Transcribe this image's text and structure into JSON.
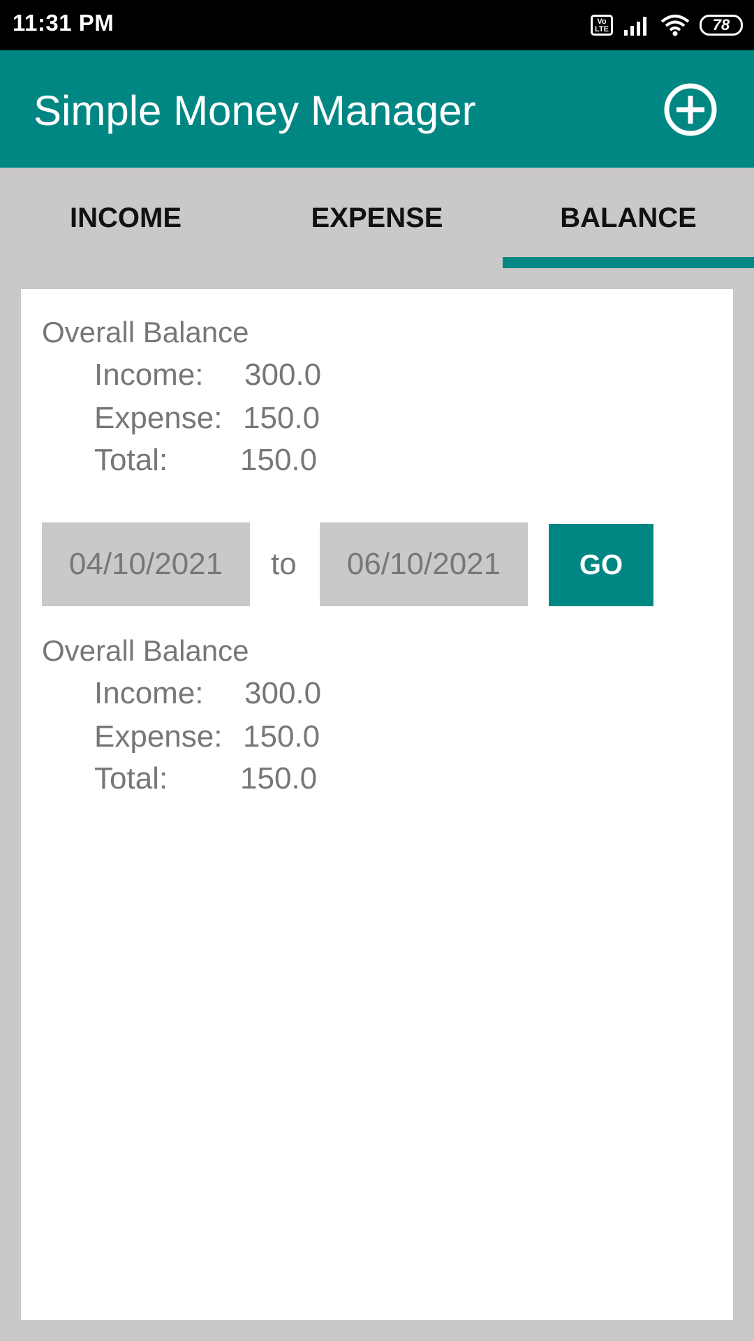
{
  "status_bar": {
    "time": "11:31 PM",
    "volte_line1": "Vo",
    "volte_line2": "LTE",
    "battery": "78"
  },
  "app_bar": {
    "title": "Simple Money Manager",
    "add_icon": "add-circle-icon"
  },
  "tabs": [
    {
      "label": "INCOME",
      "selected": false
    },
    {
      "label": "EXPENSE",
      "selected": false
    },
    {
      "label": "BALANCE",
      "selected": true
    }
  ],
  "overall": {
    "title": "Overall Balance",
    "income_label": "Income:",
    "income_value": "300.0",
    "expense_label": "Expense:",
    "expense_value": "150.0",
    "total_label": "Total:",
    "total_value": "150.0"
  },
  "date_range": {
    "from": "04/10/2021",
    "to_label": "to",
    "to": "06/10/2021",
    "go_label": "GO"
  },
  "range_balance": {
    "title": "Overall Balance",
    "income_label": "Income:",
    "income_value": "300.0",
    "expense_label": "Expense:",
    "expense_value": "150.0",
    "total_label": "Total:",
    "total_value": "150.0"
  },
  "colors": {
    "primary": "#008783",
    "status_bar": "#000000",
    "background": "#cac8c9",
    "card": "#ffffff",
    "text_secondary": "#777777"
  }
}
